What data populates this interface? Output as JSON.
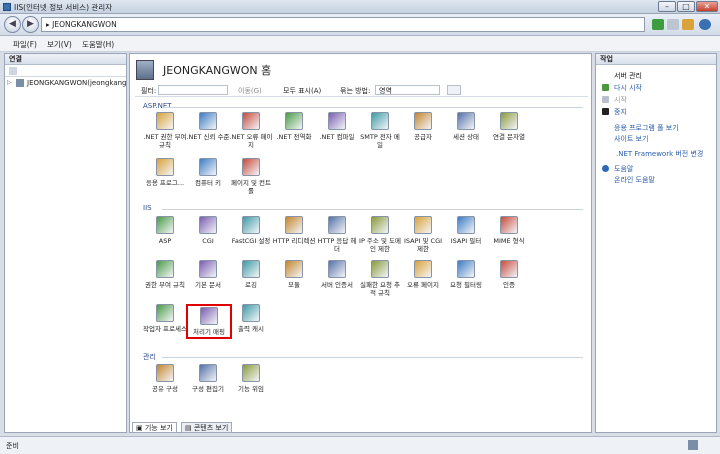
{
  "window": {
    "title": "IIS(인터넷 정보 서비스) 관리자"
  },
  "address": {
    "path": "JEONGKANGWON",
    "arrow": "▸"
  },
  "menu": [
    "파일(F)",
    "보기(V)",
    "도움말(H)"
  ],
  "left": {
    "header": "연결",
    "tree_item": "JEONGKANGWON(jeongkang"
  },
  "center": {
    "title": "JEONGKANGWON 홈",
    "filter_label": "필터:",
    "go_label": "이동(G)",
    "showall_label": "모두 표시(A)",
    "groupby_label": "묶는 방법:",
    "groupby_value": "영역"
  },
  "groups": [
    {
      "name": "ASP.NET",
      "items": [
        ".NET 권한 부여 규칙",
        ".NET 신뢰 수준",
        ".NET 오류 페이지",
        ".NET 전역화",
        ".NET 컴파일",
        "SMTP 전자 메일",
        "공급자",
        "세션 상태",
        "연결 문자열",
        "응용 프로그...",
        "컴퓨터 키",
        "페이지 및 컨트롤"
      ]
    },
    {
      "name": "IIS",
      "items": [
        "ASP",
        "CGI",
        "FastCGI 설정",
        "HTTP 리디렉션",
        "HTTP 응답 헤더",
        "IP 주소 및 도메인 제한",
        "ISAPI 및 CGI 제한",
        "ISAPI 필터",
        "MIME 형식",
        "권한 부여 규칙",
        "기본 문서",
        "로깅",
        "모듈",
        "서버 인증서",
        "실패한 요청 추적 규칙",
        "오류 페이지",
        "요청 필터링",
        "인증",
        "작업자 프로세스",
        "처리기 매핑",
        "출력 캐시"
      ]
    },
    {
      "name": "관리",
      "items": [
        "공유 구성",
        "구성 편집기",
        "기능 위임"
      ]
    }
  ],
  "tabs": [
    "기능 보기",
    "콘텐츠 보기"
  ],
  "actions": {
    "header": "작업",
    "server_mgmt": "서버 관리",
    "restart": "다시 시작",
    "start": "시작",
    "stop": "중지",
    "app_pools": "응용 프로그램 풀 보기",
    "sites": "사이트 보기",
    "netfx": ".NET Framework 버전 변경",
    "help": "도움말",
    "online_help": "온라인 도움말"
  },
  "status": {
    "text": "준비"
  },
  "colors": {
    "highlight": "#e00000",
    "link": "#2a5dab"
  }
}
